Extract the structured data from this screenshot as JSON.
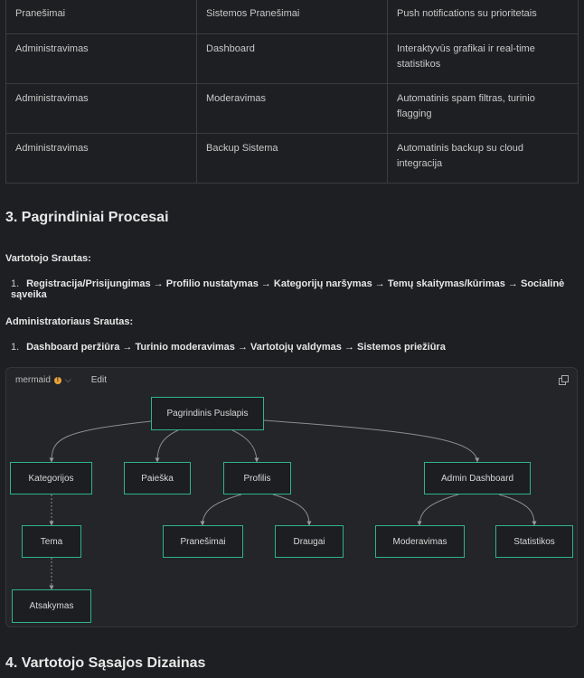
{
  "feature_table": {
    "rows": [
      [
        "Pranešimai",
        "Sistemos Pranešimai",
        "Push notifications su prioritetais"
      ],
      [
        "Administravimas",
        "Dashboard",
        "Interaktyvūs grafikai ir real-time statistikos"
      ],
      [
        "Administravimas",
        "Moderavimas",
        "Automatinis spam filtras, turinio flagging"
      ],
      [
        "Administravimas",
        "Backup Sistema",
        "Automatinis backup su cloud integracija"
      ]
    ]
  },
  "section3": {
    "title": "3. Pagrindiniai Procesai",
    "user_flow_label": "Vartotojo Srautas:",
    "user_flow_num": "1.",
    "user_flow": "Registracija/Prisijungimas → Profilio nustatymas → Kategorijų naršymas → Temų skaitymas/kūrimas → Socialinė sąveika",
    "admin_flow_label": "Administratoriaus Srautas:",
    "admin_flow_num": "1.",
    "admin_flow": "Dashboard peržiūra → Turinio moderavimas → Vartotojų valdymas → Sistemos priežiūra"
  },
  "mermaid": {
    "label": "mermaid",
    "badge": "!",
    "edit_label": "Edit",
    "icons": {
      "chevron": "chevron-down-icon",
      "copy": "copy-icon",
      "warning": "warning-icon"
    },
    "accent_color": "#2fb487",
    "nodes": {
      "root": "Pagrindinis Puslapis",
      "kategorijos": "Kategorijos",
      "paieska": "Paieška",
      "profilis": "Profilis",
      "admin": "Admin Dashboard",
      "tema": "Tema",
      "pranesimai": "Pranešimai",
      "draugai": "Draugai",
      "moderavimas": "Moderavimas",
      "statistikos": "Statistikos",
      "atsakymas": "Atsakymas"
    }
  },
  "section4": {
    "title": "4. Vartotojo Sąsajos Dizainas"
  }
}
